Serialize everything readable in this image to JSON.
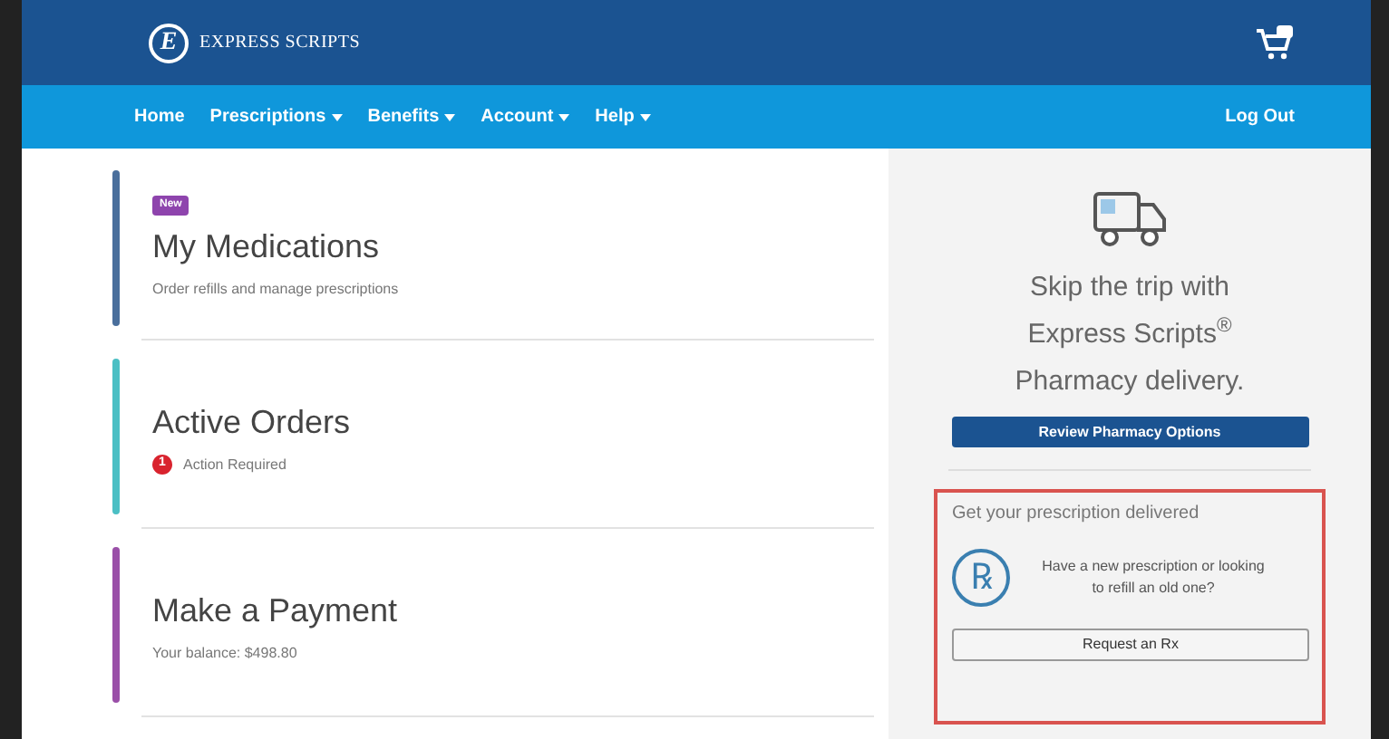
{
  "header": {
    "logo_mark": "E",
    "brand": "EXPRESS SCRIPTS"
  },
  "nav": {
    "items": [
      {
        "label": "Home",
        "dropdown": false
      },
      {
        "label": "Prescriptions",
        "dropdown": true
      },
      {
        "label": "Benefits",
        "dropdown": true
      },
      {
        "label": "Account",
        "dropdown": true
      },
      {
        "label": "Help",
        "dropdown": true
      }
    ],
    "logout": "Log Out"
  },
  "cards": [
    {
      "kind": "plain",
      "badge": "New",
      "title": "My Medications",
      "subtitle": "Order refills and manage prescriptions",
      "color": "#4a6f9c"
    },
    {
      "kind": "alert",
      "title": "Active Orders",
      "subtitle": "Action Required",
      "alert_count": "1",
      "color": "#4bbfc4"
    },
    {
      "kind": "plain",
      "title": "Make a Payment",
      "subtitle": "Your balance: $498.80",
      "color": "#9a4fa8"
    }
  ],
  "promo": {
    "lines": [
      "Skip the trip with",
      "Express Scripts$^{®}$",
      "Pharmacy delivery."
    ],
    "button": "Review Pharmacy Options"
  },
  "delivery": {
    "heading": "Get your prescription delivered",
    "icon_text": "℞",
    "text": "Have a new prescription or looking to refill an old one?",
    "button": "Request an Rx"
  }
}
